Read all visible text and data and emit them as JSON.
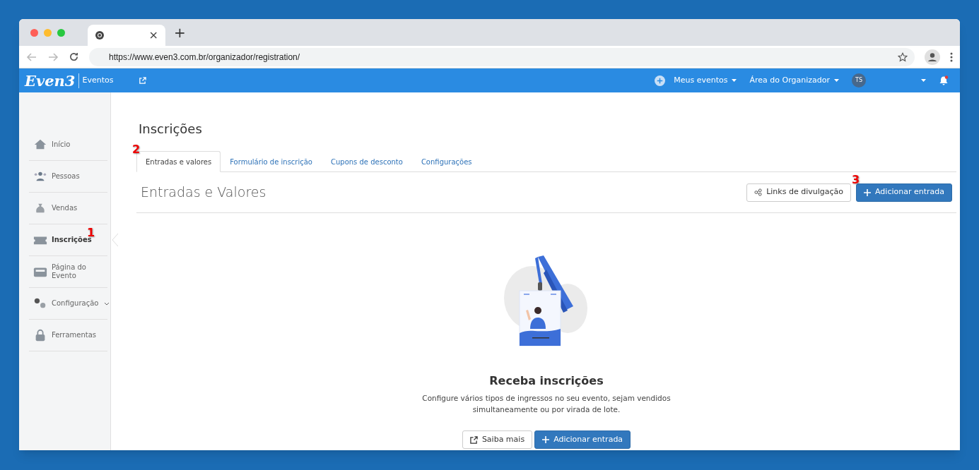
{
  "browser": {
    "tab_close": "×",
    "new_tab": "+",
    "url": "https://www.even3.com.br/organizador/registration/"
  },
  "header": {
    "logo": "Even3",
    "section": "Eventos",
    "menus": [
      {
        "label": "Meus eventos"
      },
      {
        "label": "Área do Organizador"
      }
    ],
    "avatar": "TS"
  },
  "sidebar": {
    "items": [
      {
        "label": "Início",
        "selected": false,
        "chevron": false
      },
      {
        "label": "Pessoas",
        "selected": false,
        "chevron": false
      },
      {
        "label": "Vendas",
        "selected": false,
        "chevron": false
      },
      {
        "label": "Inscrições",
        "selected": true,
        "chevron": false,
        "annotation": "1"
      },
      {
        "label": "Página do Evento",
        "selected": false,
        "chevron": false
      },
      {
        "label": "Configuração",
        "selected": false,
        "chevron": true
      },
      {
        "label": "Ferramentas",
        "selected": false,
        "chevron": false
      }
    ]
  },
  "page": {
    "title": "Inscrições",
    "tabs": [
      {
        "label": "Entradas e valores",
        "selected": true,
        "annotation": "2"
      },
      {
        "label": "Formulário de inscrição",
        "selected": false
      },
      {
        "label": "Cupons de desconto",
        "selected": false
      },
      {
        "label": "Configurações",
        "selected": false
      }
    ],
    "section_title": "Entradas e Valores",
    "toolbar": [
      {
        "label": "Links de divulgação",
        "kind": "secondary"
      },
      {
        "label": "Adicionar entrada",
        "kind": "primary",
        "annotation": "3"
      }
    ],
    "empty_state": {
      "heading": "Receba inscrições",
      "text": "Configure vários tipos de ingressos no seu evento, sejam vendidos simultaneamente ou por virada de lote.",
      "buttons": [
        {
          "label": "Saiba mais",
          "kind": "secondary"
        },
        {
          "label": "Adicionar entrada",
          "kind": "primary"
        }
      ]
    }
  }
}
